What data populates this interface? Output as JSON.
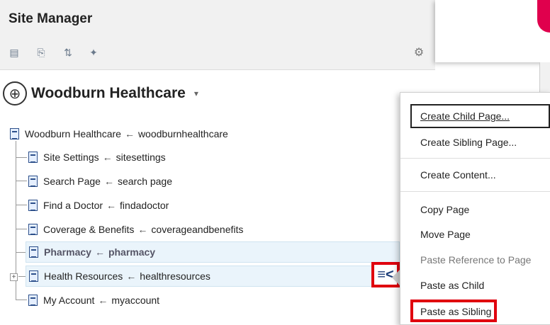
{
  "panel": {
    "title": "Site Manager",
    "toolbar": [
      {
        "icon": "site-structure-icon",
        "glyph": "▤"
      },
      {
        "icon": "page-copy-icon",
        "glyph": "⎘"
      },
      {
        "icon": "move-up-down-icon",
        "glyph": "⇅"
      },
      {
        "icon": "sort-icon",
        "glyph": "✦"
      }
    ],
    "gear_icon": "⚙"
  },
  "site": {
    "name": "Woodburn Healthcare",
    "icon": "globe-icon",
    "caret": "▾"
  },
  "tree": {
    "arrow": "←",
    "root": {
      "label": "Woodburn Healthcare",
      "path": "woodburnhealthcare"
    },
    "children": [
      {
        "label": "Site Settings",
        "path": "sitesettings"
      },
      {
        "label": "Search Page",
        "path": "search page"
      },
      {
        "label": "Find a Doctor",
        "path": "findadoctor"
      },
      {
        "label": "Coverage & Benefits",
        "path": "coverageandbenefits"
      },
      {
        "label": "Pharmacy",
        "path": "pharmacy"
      },
      {
        "label": "Health Resources",
        "path": "healthresources"
      },
      {
        "label": "My Account",
        "path": "myaccount"
      }
    ],
    "expander": "+",
    "menu_trigger_glyph": "≡<"
  },
  "context_menu": {
    "items": [
      {
        "label": "Create Child Page...",
        "disabled": false
      },
      {
        "label": "Create Sibling Page...",
        "disabled": false
      },
      {
        "label": "Create Content...",
        "disabled": false
      },
      {
        "label": "Copy Page",
        "disabled": false
      },
      {
        "label": "Move Page",
        "disabled": false
      },
      {
        "label": "Paste Reference to Page",
        "disabled": true
      },
      {
        "label": "Paste as Child",
        "disabled": false
      },
      {
        "label": "Paste as Sibling",
        "disabled": false
      }
    ]
  },
  "colors": {
    "highlight": "#e0000e",
    "brand": "#e0004d",
    "selected_row": "#eaf4fb"
  }
}
